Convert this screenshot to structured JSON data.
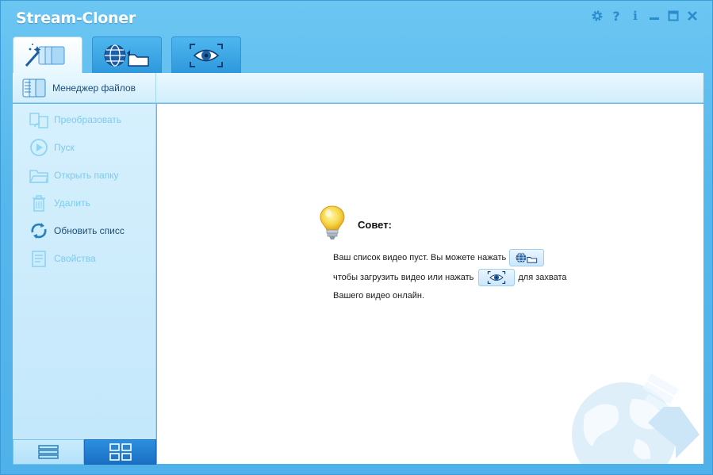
{
  "app": {
    "title": "Stream-Cloner"
  },
  "title_controls": [
    {
      "icon": "gear-icon"
    },
    {
      "icon": "help-icon",
      "glyph": "?"
    },
    {
      "icon": "info-icon",
      "glyph": "i"
    },
    {
      "icon": "minimize-icon"
    },
    {
      "icon": "maximize-icon"
    },
    {
      "icon": "close-icon"
    }
  ],
  "tabs": [
    {
      "icon": "files-wand-icon",
      "active": true
    },
    {
      "icon": "globe-folder-icon",
      "active": false
    },
    {
      "icon": "eye-capture-icon",
      "active": false
    }
  ],
  "toolbar": {
    "file_manager_label": "Менеджер файлов"
  },
  "sidebar": {
    "items": [
      {
        "label": "Преобразовать",
        "icon": "convert-icon",
        "enabled": false
      },
      {
        "label": "Пуск",
        "icon": "play-icon",
        "enabled": false
      },
      {
        "label": "Открыть папку",
        "icon": "folder-icon",
        "enabled": false
      },
      {
        "label": "Удалить",
        "icon": "trash-icon",
        "enabled": false
      },
      {
        "label": "Обновить списс",
        "icon": "refresh-icon",
        "enabled": true
      },
      {
        "label": "Свойства",
        "icon": "properties-icon",
        "enabled": false
      }
    ]
  },
  "view_buttons": [
    {
      "icon": "list-view-icon",
      "active": false
    },
    {
      "icon": "grid-view-icon",
      "active": true
    }
  ],
  "tip": {
    "title": "Совет:",
    "line1": "Ваш список видео пуст. Вы можете нажать",
    "line2_a": "чтобы загрузить видео или нажать",
    "line2_b": "для захвата",
    "line3": "Вашего видео онлайн."
  },
  "colors": {
    "window_blue": "#55b7ec",
    "panel_light": "#d6f0fd",
    "accent_dark_blue": "#1b6fc2",
    "disabled_text": "#7ccbef"
  }
}
